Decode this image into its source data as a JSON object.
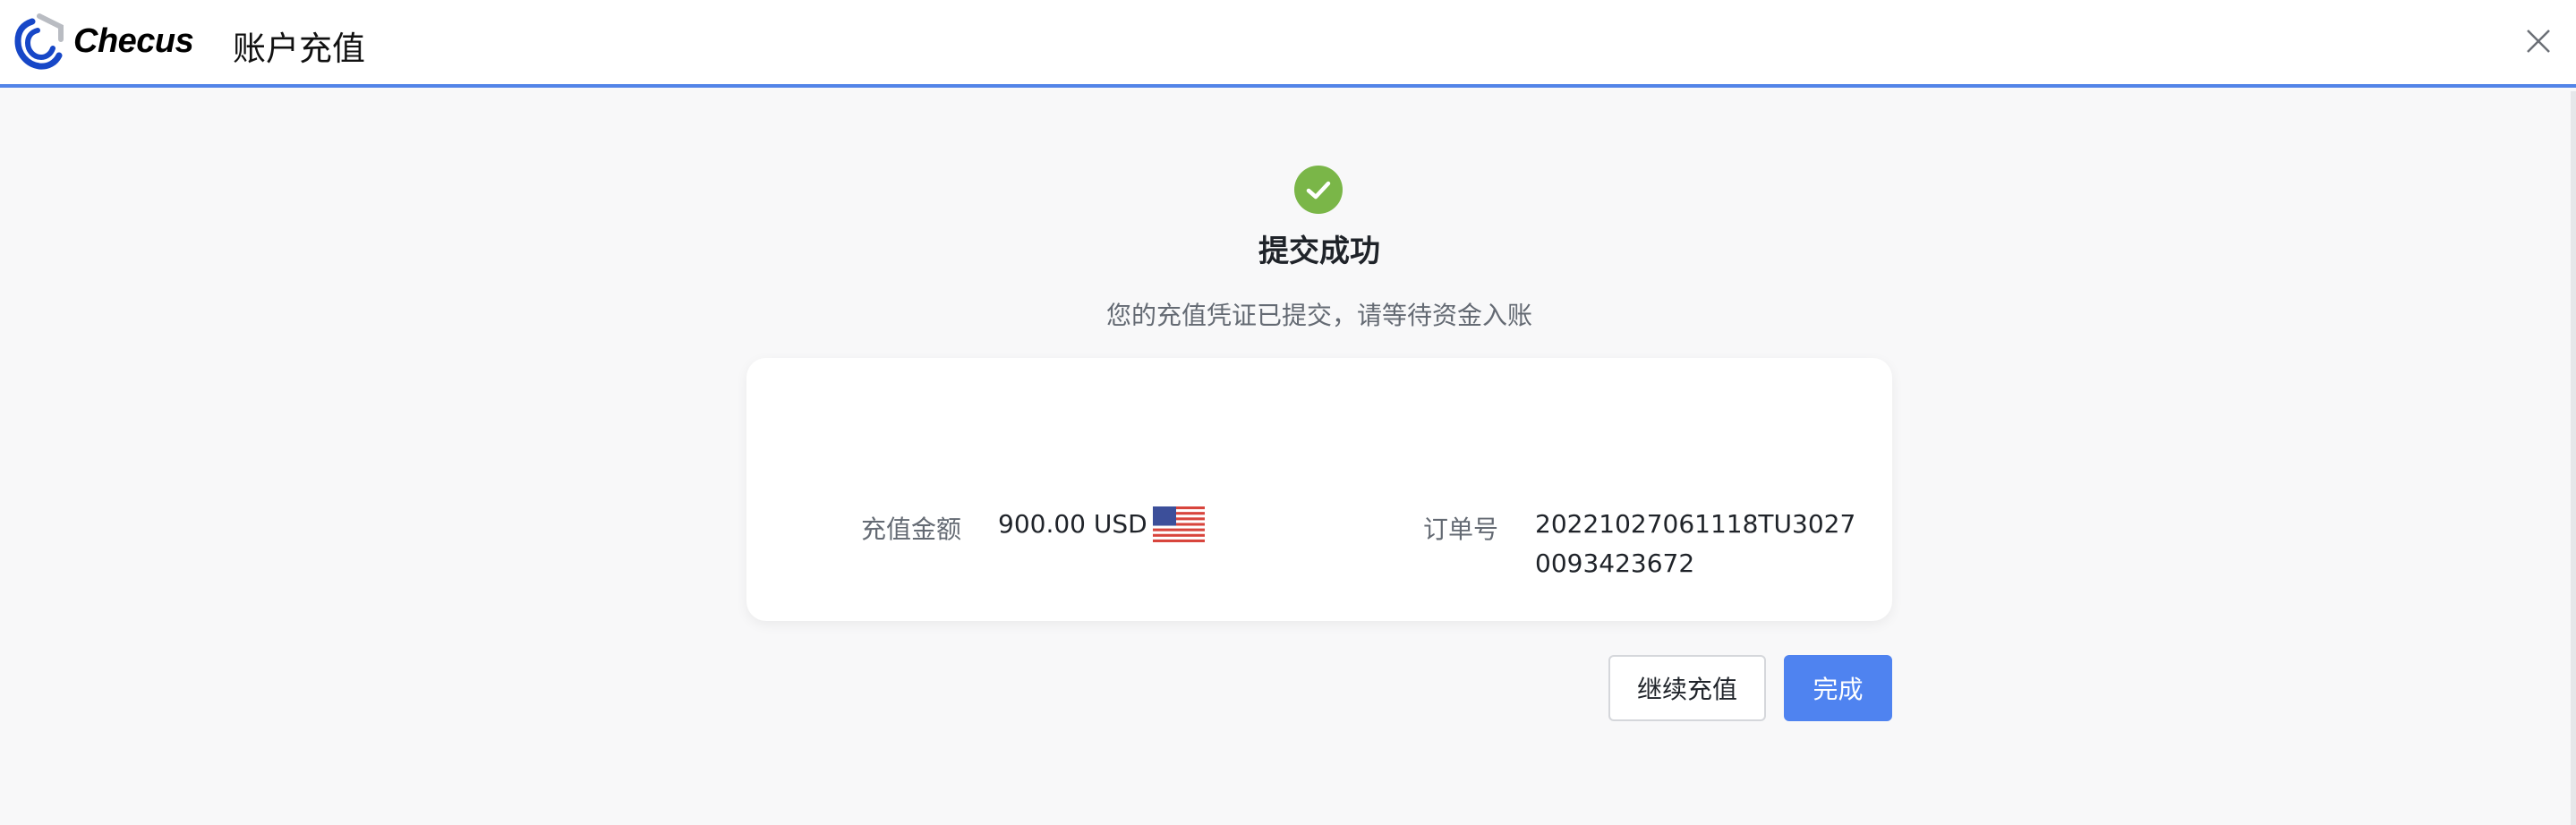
{
  "header": {
    "brand": "Checus",
    "title": "账户充值"
  },
  "result": {
    "title": "提交成功",
    "description": "您的充值凭证已提交，请等待资金入账"
  },
  "details": {
    "amount_label": "充值金额",
    "amount_value": "900.00 USD",
    "currency_flag": "us-flag-icon",
    "order_label": "订单号",
    "order_value_line1": "20221027061118TU3027",
    "order_value_line2": "0093423672"
  },
  "actions": {
    "continue_label": "继续充值",
    "done_label": "完成"
  },
  "colors": {
    "accent": "#4f83f0",
    "success": "#7ab648",
    "header_border": "#5284e8"
  }
}
